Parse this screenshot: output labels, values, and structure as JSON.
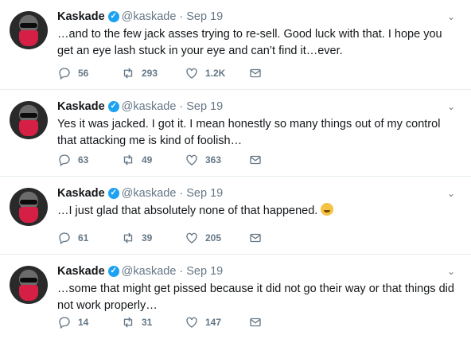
{
  "tweets": [
    {
      "name": "Kaskade",
      "handle": "@kaskade",
      "separator": "·",
      "date": "Sep 19",
      "text": "…and to the few jack asses trying to re-sell.  Good luck with that.  I hope you get an eye lash stuck in your eye and can’t find it…ever.",
      "replies": "56",
      "retweets": "293",
      "likes": "1.2K"
    },
    {
      "name": "Kaskade",
      "handle": "@kaskade",
      "separator": "·",
      "date": "Sep 19",
      "text": "Yes it was jacked.  I got it.  I mean honestly so many things out of my control that attacking me is kind of foolish…",
      "replies": "63",
      "retweets": "49",
      "likes": "363"
    },
    {
      "name": "Kaskade",
      "handle": "@kaskade",
      "separator": "·",
      "date": "Sep 19",
      "text": "…I just glad that absolutely none of that happened.",
      "emoji": "grinning-sweat-emoji",
      "replies": "61",
      "retweets": "39",
      "likes": "205"
    },
    {
      "name": "Kaskade",
      "handle": "@kaskade",
      "separator": "·",
      "date": "Sep 19",
      "text": "…some that might get pissed because it did not go their way or that things did not work properly…",
      "replies": "14",
      "retweets": "31",
      "likes": "147"
    }
  ],
  "icons": {
    "verified": "verified-badge-icon",
    "caret": "chevron-down-icon",
    "reply": "reply-icon",
    "retweet": "retweet-icon",
    "like": "heart-icon",
    "dm": "envelope-icon"
  },
  "colors": {
    "verified": "#1da1f2",
    "meta": "#657786",
    "text": "#14171a",
    "divider": "#e6ecf0"
  }
}
